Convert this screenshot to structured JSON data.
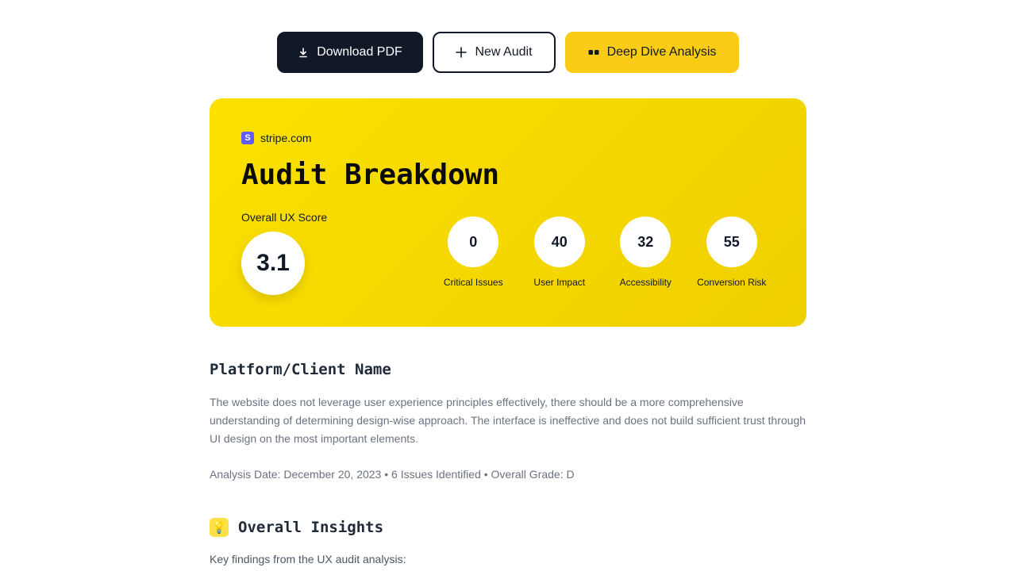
{
  "toolbar": {
    "download_label": "Download PDF",
    "new_audit_label": "New Audit",
    "deep_dive_label": "Deep Dive Analysis"
  },
  "hero": {
    "domain": "stripe.com",
    "domain_badge": "S",
    "title": "Audit Breakdown",
    "score_label": "Overall UX Score",
    "score_value": "3.1",
    "metrics": [
      {
        "value": "0",
        "label": "Critical Issues"
      },
      {
        "value": "40",
        "label": "User Impact"
      },
      {
        "value": "32",
        "label": "Accessibility"
      },
      {
        "value": "55",
        "label": "Conversion Risk"
      }
    ]
  },
  "summary": {
    "title": "Platform/Client Name",
    "paragraph": "The website does not leverage user experience principles effectively, there should be a more comprehensive understanding of determining design-wise approach. The interface is ineffective and does not build sufficient trust through UI design on the most important elements.",
    "meta": "Analysis Date: December 20, 2023 • 6 Issues Identified • Overall Grade: D"
  },
  "insights": {
    "title": "Overall Insights",
    "icon": "lightbulb-icon",
    "subtitle": "Key findings from the UX audit analysis:"
  },
  "colors": {
    "dark": "#111827",
    "accent_yellow": "#facc15",
    "hero_yellow": "#f5d800",
    "muted_text": "#6b7280"
  }
}
